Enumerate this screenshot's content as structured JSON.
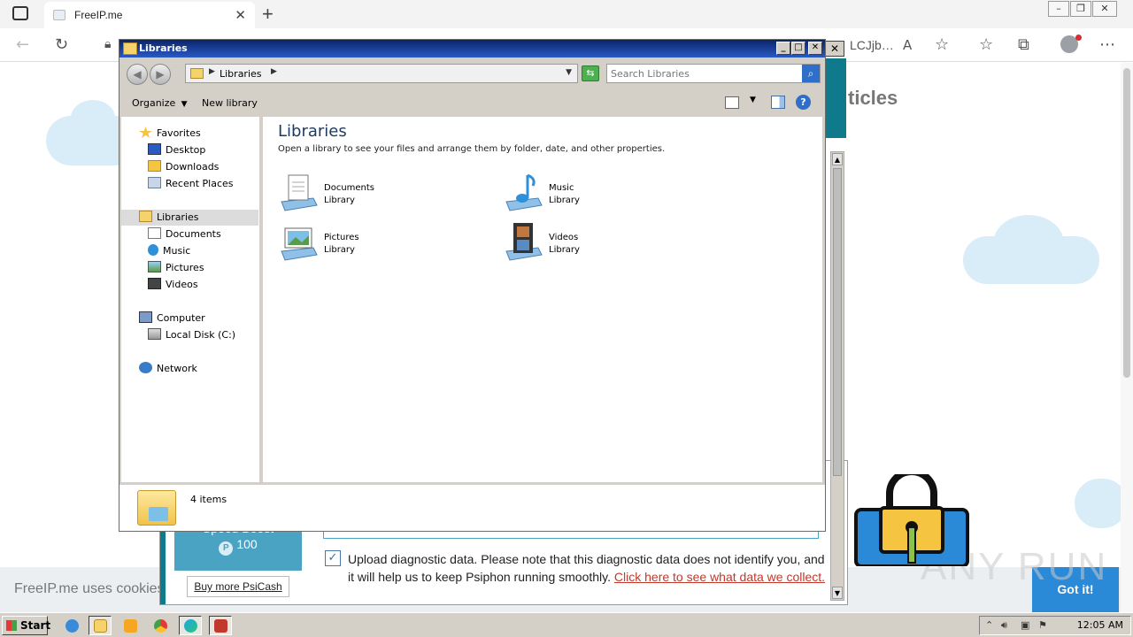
{
  "browser": {
    "tab_title": "FreeIP.me",
    "url_fragment": "LCJjb…",
    "tab_close": "✕",
    "new_tab": "+"
  },
  "page": {
    "heading_fragment": "ticles",
    "cookie_text": "FreeIP.me uses cookies",
    "got_it_label": "Got it!",
    "watermark": "ANY RUN"
  },
  "psiphon": {
    "speed_boost_label": "Speed Boost",
    "speed_boost_value": "100",
    "psicash_symbol": "P",
    "buy_label": "Buy more PsiCash",
    "diag_checked": "✓",
    "diag_text": "Upload diagnostic data. Please note that this diagnostic data does not identify you, and it will help us to keep Psiphon running smoothly. ",
    "diag_link": "Click here to see what data we collect."
  },
  "explorer": {
    "window_title": "Libraries",
    "address_crumb": "Libraries",
    "search_placeholder": "Search Libraries",
    "organize_label": "Organize",
    "new_library_label": "New library",
    "nav": {
      "favorites": "Favorites",
      "desktop": "Desktop",
      "downloads": "Downloads",
      "recent_places": "Recent Places",
      "libraries": "Libraries",
      "documents": "Documents",
      "music": "Music",
      "pictures": "Pictures",
      "videos": "Videos",
      "computer": "Computer",
      "local_disk": "Local Disk (C:)",
      "network": "Network"
    },
    "content_title": "Libraries",
    "content_desc": "Open a library to see your files and arrange them by folder, date, and other properties.",
    "libraries": [
      {
        "name": "Documents",
        "type": "Library"
      },
      {
        "name": "Music",
        "type": "Library"
      },
      {
        "name": "Pictures",
        "type": "Library"
      },
      {
        "name": "Videos",
        "type": "Library"
      }
    ],
    "status": "4 items"
  },
  "taskbar": {
    "start_label": "Start",
    "clock": "12:05 AM"
  },
  "colors": {
    "titlebar": "#0a246a",
    "psiphon_teal": "#0f7a8c",
    "speed_boost": "#4aa3c3",
    "got_it": "#2a8ad8",
    "link_red": "#c0392b"
  }
}
